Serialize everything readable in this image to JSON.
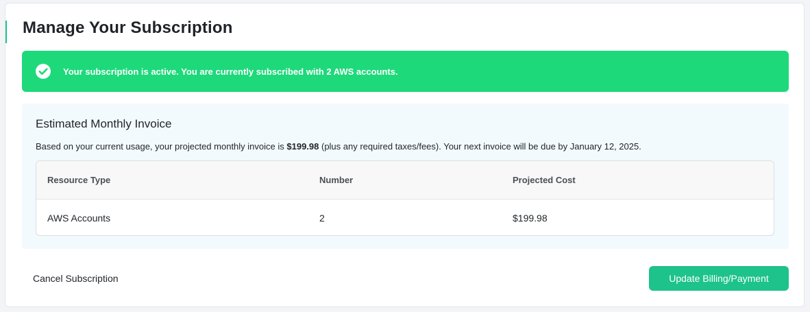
{
  "page": {
    "title": "Manage Your Subscription"
  },
  "alert": {
    "icon": "check-circle-icon",
    "message": "Your subscription is active. You are currently subscribed with 2 AWS accounts.",
    "color": "#1dd97a"
  },
  "invoice": {
    "title": "Estimated Monthly Invoice",
    "desc_prefix": "Based on your current usage, your projected monthly invoice is ",
    "amount": "$199.98",
    "desc_suffix": " (plus any required taxes/fees). Your next invoice will be due by January 12, 2025.",
    "table": {
      "headers": [
        "Resource Type",
        "Number",
        "Projected Cost"
      ],
      "rows": [
        [
          "AWS Accounts",
          "2",
          "$199.98"
        ]
      ]
    }
  },
  "actions": {
    "cancel_label": "Cancel Subscription",
    "update_label": "Update Billing/Payment",
    "accent_color": "#1ec28b"
  }
}
